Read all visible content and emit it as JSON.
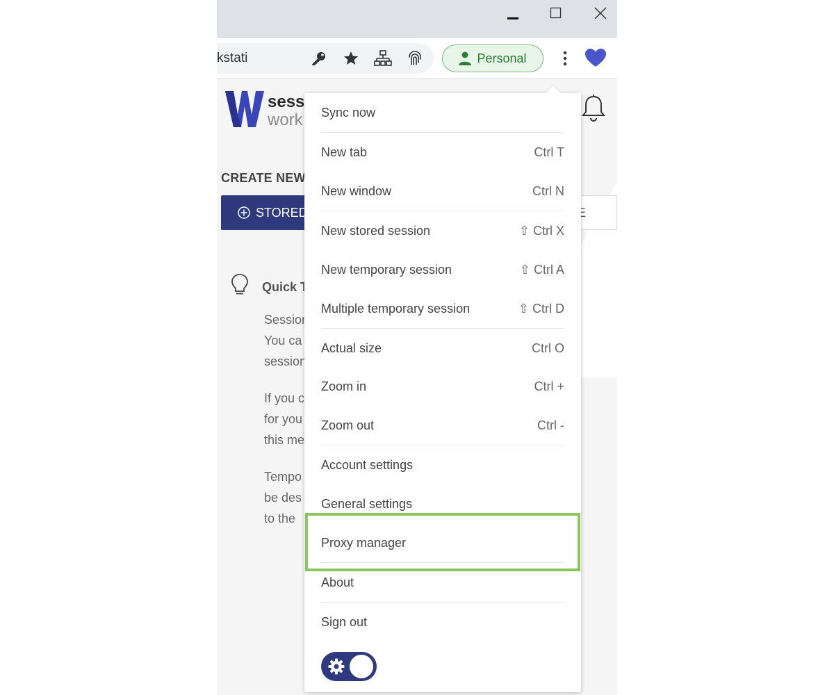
{
  "toolbar": {
    "url_fragment": "kstati",
    "profile_label": "Personal"
  },
  "page": {
    "brand_line1": "sessi",
    "brand_line2": "work",
    "create_label": "CREATE NEW",
    "stored_button": "STORED",
    "multiple_button": "PLE",
    "tips_title": "Quick T",
    "tips_lines": [
      "Session",
      "You  ca",
      "session",
      "If you c",
      "for you",
      "this me",
      "Tempo",
      "be des",
      "to the"
    ]
  },
  "menu": {
    "items": [
      {
        "label": "Sync now",
        "shortcut": ""
      },
      {
        "label": "New tab",
        "shortcut": "Ctrl T"
      },
      {
        "label": "New window",
        "shortcut": "Ctrl N"
      },
      {
        "label": "New stored session",
        "shortcut": "⇧ Ctrl X"
      },
      {
        "label": "New temporary session",
        "shortcut": "⇧ Ctrl A"
      },
      {
        "label": "Multiple temporary session",
        "shortcut": "⇧ Ctrl D"
      },
      {
        "label": "Actual size",
        "shortcut": "Ctrl O"
      },
      {
        "label": "Zoom in",
        "shortcut": "Ctrl +"
      },
      {
        "label": "Zoom out",
        "shortcut": "Ctrl -"
      },
      {
        "label": "Account settings",
        "shortcut": ""
      },
      {
        "label": "General settings",
        "shortcut": ""
      },
      {
        "label": "Proxy manager",
        "shortcut": ""
      },
      {
        "label": "About",
        "shortcut": ""
      },
      {
        "label": "Sign out",
        "shortcut": ""
      }
    ]
  },
  "icons": [
    "minimize-icon",
    "maximize-icon",
    "close-icon",
    "key-icon",
    "star-icon",
    "network-icon",
    "fingerprint-icon",
    "person-icon",
    "kebab-menu-icon",
    "heart-icon",
    "logo-w",
    "bell-icon",
    "plus-circle-icon",
    "lightbulb-icon",
    "gear-icon"
  ],
  "colors": {
    "accent": "#2f3a7e",
    "highlight": "#8bc75d",
    "profile_green": "#2e7d32",
    "heart": "#4a55c9"
  }
}
